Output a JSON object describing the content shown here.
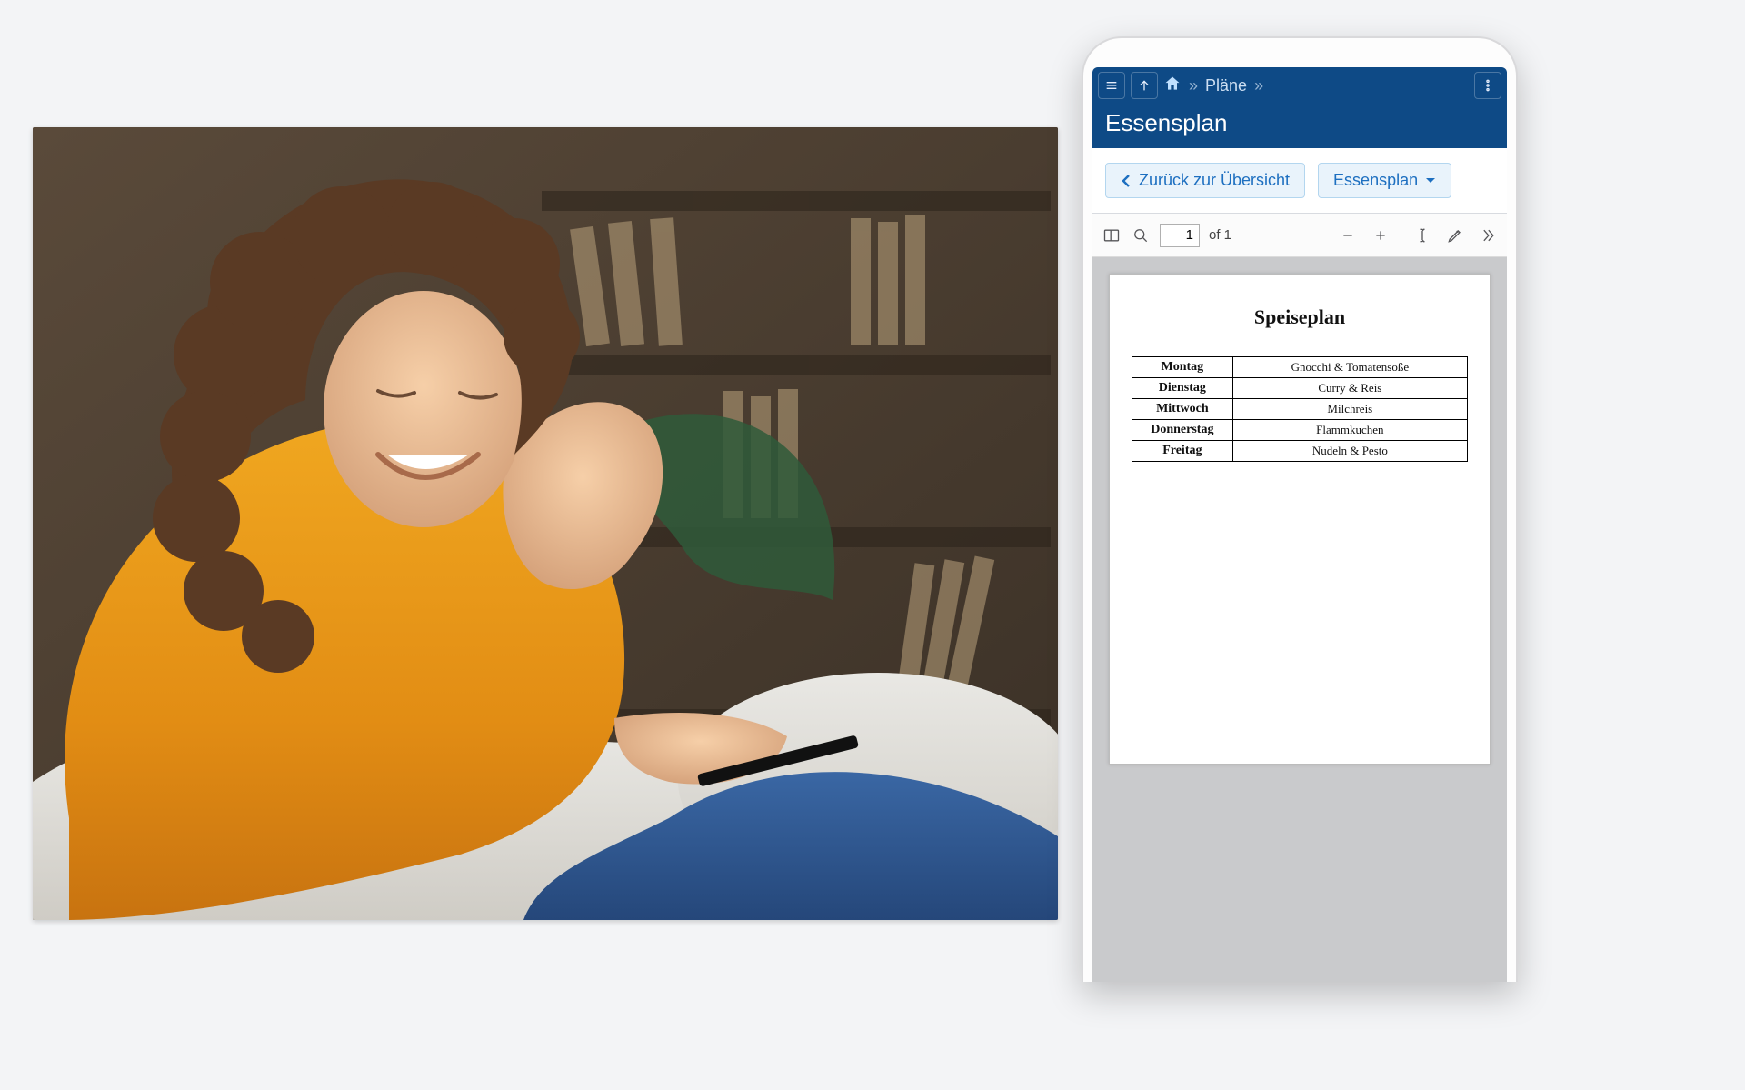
{
  "header": {
    "breadcrumb_section": "Pläne"
  },
  "page_title": "Essensplan",
  "actions": {
    "back_label": "Zurück zur Übersicht",
    "dropdown_label": "Essensplan"
  },
  "pdf": {
    "current_page": "1",
    "total_pages_label": "of 1"
  },
  "document": {
    "title": "Speiseplan",
    "rows": [
      {
        "day": "Montag",
        "meal": "Gnocchi & Tomatensoße"
      },
      {
        "day": "Dienstag",
        "meal": "Curry & Reis"
      },
      {
        "day": "Mittwoch",
        "meal": "Milchreis"
      },
      {
        "day": "Donnerstag",
        "meal": "Flammkuchen"
      },
      {
        "day": "Freitag",
        "meal": "Nudeln & Pesto"
      }
    ]
  }
}
